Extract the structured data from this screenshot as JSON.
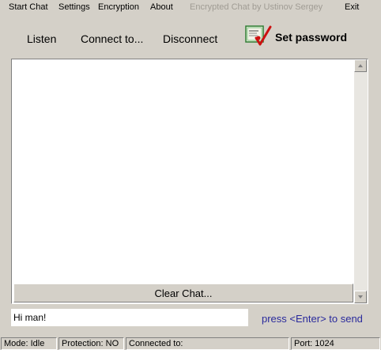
{
  "menu": {
    "start_chat": "Start Chat",
    "settings": "Settings",
    "encryption": "Encryption",
    "about": "About",
    "caption": "Encrypted Chat  by Ustinov Sergey",
    "exit": "Exit"
  },
  "toolbar": {
    "listen": "Listen",
    "connect": "Connect to...",
    "disconnect": "Disconnect",
    "set_password": "Set password",
    "set_password_icon": "certificate-check-icon"
  },
  "chat": {
    "clear_label": "Clear Chat..."
  },
  "input": {
    "value": "Hi man!",
    "hint": "press <Enter> to send"
  },
  "status": {
    "mode": "Mode: Idle",
    "protection": "Protection: NO",
    "connected": "Connected to:",
    "port": "Port: 1024"
  },
  "colors": {
    "background": "#d4d0c8",
    "hint_text": "#2a2a9c",
    "caption_text": "#a09c94",
    "check_mark": "#cc1111"
  }
}
